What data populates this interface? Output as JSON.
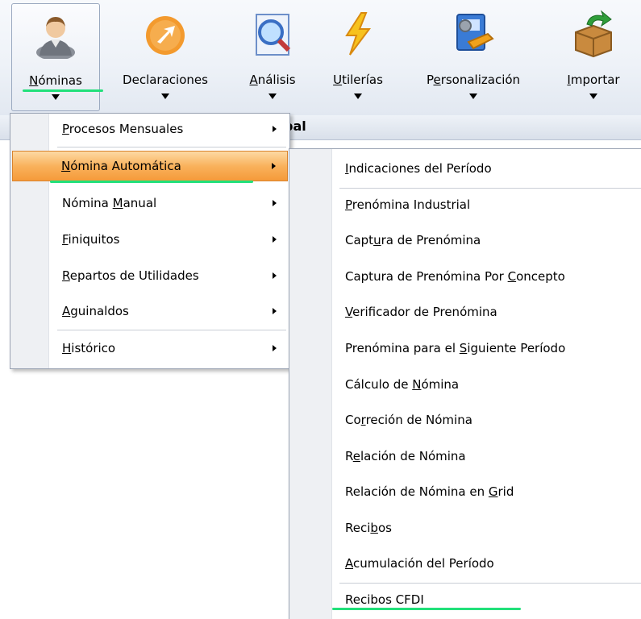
{
  "toolbar": {
    "items": [
      {
        "label": "Nóminas",
        "mnemonic": "N",
        "rest": "óminas",
        "icon": "user-icon"
      },
      {
        "label": "Declaraciones",
        "mnemonic": "",
        "rest": "Declaraciones",
        "icon": "arrow-circle-icon"
      },
      {
        "label": "Análisis",
        "mnemonic": "A",
        "rest": "nálisis",
        "icon": "magnifier-document-icon"
      },
      {
        "label": "Utilerías",
        "mnemonic": "U",
        "rest": "tilerías",
        "icon": "lightning-icon"
      },
      {
        "label": "Personalización",
        "pre": "P",
        "mnemonic": "e",
        "rest": "rsonalización",
        "icon": "tools-icon"
      },
      {
        "label": "Importar",
        "mnemonic": "I",
        "rest": "mportar",
        "icon": "import-box-icon"
      }
    ]
  },
  "panel": {
    "title_fragment": "bal"
  },
  "menu1": {
    "items": [
      {
        "pre": "",
        "m": "P",
        "post": "rocesos Mensuales"
      },
      {
        "pre": "",
        "m": "N",
        "post": "ómina Automática"
      },
      {
        "pre": "Nómina ",
        "m": "M",
        "post": "anual"
      },
      {
        "pre": "",
        "m": "F",
        "post": "iniquitos"
      },
      {
        "pre": "",
        "m": "R",
        "post": "epartos de Utilidades"
      },
      {
        "pre": "",
        "m": "A",
        "post": "guinaldos"
      },
      {
        "pre": "",
        "m": "H",
        "post": "istórico"
      }
    ]
  },
  "menu2": {
    "items": [
      {
        "pre": "",
        "m": "I",
        "post": "ndicaciones del Período"
      },
      {
        "pre": "",
        "m": "P",
        "post": "renómina Industrial"
      },
      {
        "pre": "Capt",
        "m": "u",
        "post": "ra de Prenómina"
      },
      {
        "pre": "Captura de Prenómina Por ",
        "m": "C",
        "post": "oncepto"
      },
      {
        "pre": "",
        "m": "V",
        "post": "erificador de Prenómina"
      },
      {
        "pre": "Prenómina para el ",
        "m": "S",
        "post": "iguiente Período"
      },
      {
        "pre": "Cálculo de ",
        "m": "N",
        "post": "ómina"
      },
      {
        "pre": "Co",
        "m": "r",
        "post": "reción de Nómina"
      },
      {
        "pre": "R",
        "m": "e",
        "post": "lación de Nómina"
      },
      {
        "pre": "Relación de Nómina en ",
        "m": "G",
        "post": "rid"
      },
      {
        "pre": "Reci",
        "m": "b",
        "post": "os"
      },
      {
        "pre": "",
        "m": "A",
        "post": "cumulación del Período"
      },
      {
        "pre": "Recibos CFDI",
        "m": "",
        "post": ""
      }
    ]
  },
  "colors": {
    "highlight": "#f9b25c",
    "annotation": "#22e07a"
  }
}
